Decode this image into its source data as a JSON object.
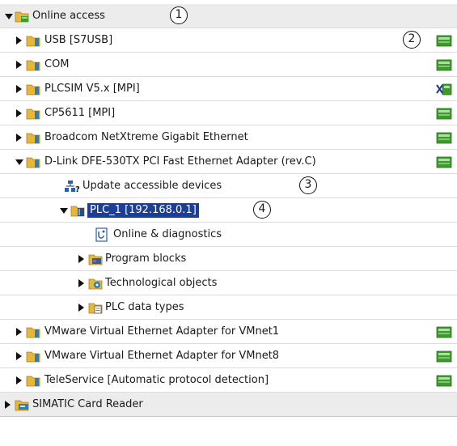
{
  "tree": {
    "items": [
      {
        "label": "Online access",
        "expanded": true,
        "icon": "online-access-folder-icon",
        "callout": "1"
      },
      {
        "label": "USB [S7USB]",
        "expanded": false,
        "icon": "interface-folder-icon",
        "status": "connected-network-icon",
        "callout": "2"
      },
      {
        "label": "COM",
        "expanded": false,
        "icon": "interface-folder-icon",
        "status": "connected-network-icon"
      },
      {
        "label": "PLCSIM V5.x [MPI]",
        "expanded": false,
        "icon": "interface-folder-icon",
        "status": "disconnected-network-icon"
      },
      {
        "label": "CP5611 [MPI]",
        "expanded": false,
        "icon": "interface-folder-icon",
        "status": "connected-network-icon"
      },
      {
        "label": "Broadcom NetXtreme Gigabit Ethernet",
        "expanded": false,
        "icon": "interface-folder-icon",
        "status": "connected-network-icon"
      },
      {
        "label": "D-Link DFE-530TX PCI Fast Ethernet Adapter (rev.C)",
        "expanded": true,
        "icon": "interface-folder-icon",
        "status": "connected-network-icon"
      },
      {
        "label": "Update accessible devices",
        "icon": "update-devices-icon",
        "callout": "3"
      },
      {
        "label": "PLC_1 [192.168.0.1]",
        "expanded": true,
        "selected": true,
        "icon": "plc-device-icon",
        "callout": "4"
      },
      {
        "label": "Online & diagnostics",
        "icon": "online-diagnostics-icon"
      },
      {
        "label": "Program blocks",
        "expanded": false,
        "icon": "program-blocks-folder-icon"
      },
      {
        "label": "Technological objects",
        "expanded": false,
        "icon": "technological-objects-folder-icon"
      },
      {
        "label": "PLC data types",
        "expanded": false,
        "icon": "plc-data-types-folder-icon"
      },
      {
        "label": "VMware Virtual Ethernet Adapter for VMnet1",
        "expanded": false,
        "icon": "interface-folder-icon",
        "status": "connected-network-icon"
      },
      {
        "label": "VMware Virtual Ethernet Adapter for VMnet8",
        "expanded": false,
        "icon": "interface-folder-icon",
        "status": "connected-network-icon"
      },
      {
        "label": "TeleService [Automatic protocol detection]",
        "expanded": false,
        "icon": "interface-folder-icon",
        "status": "connected-network-icon"
      },
      {
        "label": "SIMATIC Card Reader",
        "expanded": false,
        "icon": "card-reader-folder-icon"
      }
    ]
  },
  "colors": {
    "selection": "#1c3f95",
    "folder": "#e8b73a",
    "status_green": "#3f9a2e"
  }
}
